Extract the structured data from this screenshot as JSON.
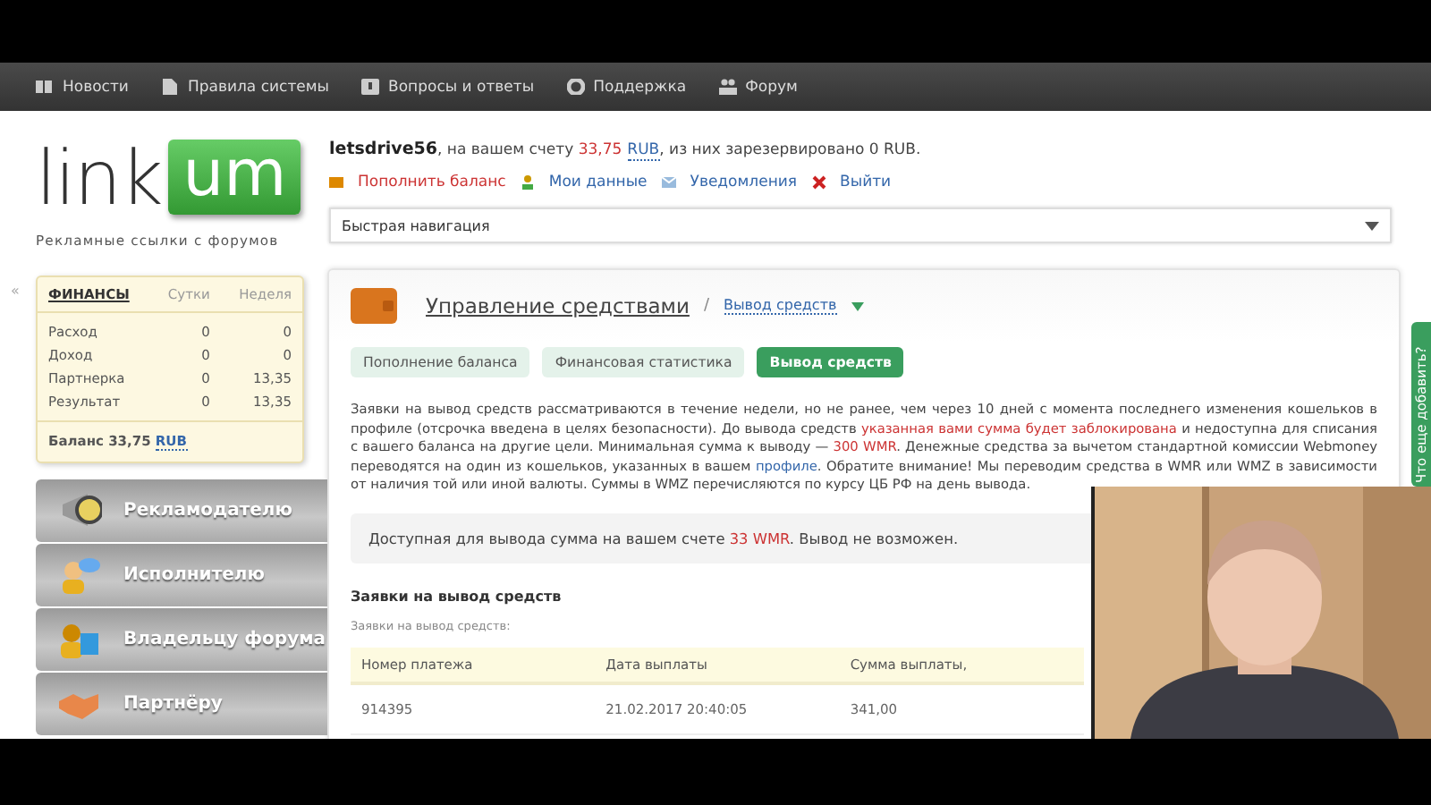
{
  "top_nav": {
    "items": [
      {
        "label": "Новости"
      },
      {
        "label": "Правила системы"
      },
      {
        "label": "Вопросы и ответы"
      },
      {
        "label": "Поддержка"
      },
      {
        "label": "Форум"
      }
    ]
  },
  "logo": {
    "text_left": "link",
    "text_right": "um",
    "tagline": "Рекламные ссылки с форумов"
  },
  "account": {
    "summary": [
      {
        "text": "letsdrive56",
        "kind": "strong"
      },
      {
        "text": ", на вашем счету ",
        "kind": "plain"
      },
      {
        "text": "33,75",
        "kind": "accent"
      },
      {
        "text": "RUB",
        "kind": "link"
      },
      {
        "text": ", из них зарезервировано 0 RUB.",
        "kind": "plain"
      }
    ],
    "links": [
      {
        "label": "Пополнить баланс",
        "kind": "deposit"
      },
      {
        "label": "Мои данные",
        "kind": "profile"
      },
      {
        "label": "Уведомления",
        "kind": "mail"
      },
      {
        "label": "Выйти",
        "kind": "logout"
      }
    ]
  },
  "quick_nav": {
    "value": "Быстрая навигация"
  },
  "collapse_toggle": "«",
  "finance": {
    "columns": [
      "ФИНАНСЫ",
      "Сутки",
      "Неделя"
    ],
    "rows": [
      [
        "Расход",
        "0",
        "0"
      ],
      [
        "Доход",
        "0",
        "0"
      ],
      [
        "Партнерка",
        "0",
        "13,35"
      ],
      [
        "Результат",
        "0",
        "13,35"
      ]
    ],
    "balance": [
      {
        "text": "Баланс 33,75 ",
        "kind": "strong"
      },
      {
        "text": "RUB",
        "kind": "link"
      }
    ]
  },
  "side_menu": [
    {
      "label": "Рекламодателю"
    },
    {
      "label": "Исполнителю"
    },
    {
      "label": "Владельцу форума"
    },
    {
      "label": "Партнёру"
    }
  ],
  "main": {
    "title": "Управление средствами",
    "separator": "/",
    "breadcrumb": "Вывод средств",
    "tabs": [
      {
        "label": "Пополнение баланса",
        "selected": false
      },
      {
        "label": "Финансовая статистика",
        "selected": false
      },
      {
        "label": "Вывод средств",
        "selected": true
      }
    ],
    "description": [
      {
        "text": "Заявки на вывод средств рассматриваются в течение недели, но не ранее, чем через 10 дней с момента последнего изменения кошельков в профиле (отсрочка введена в целях безопасности). До вывода средств ",
        "kind": "plain"
      },
      {
        "text": "указанная вами сумма будет заблокирована",
        "kind": "accent"
      },
      {
        "text": " и недоступна для списания с вашего баланса на другие цели. Минимальная сумма к выводу — ",
        "kind": "plain"
      },
      {
        "text": "300 WMR",
        "kind": "accent"
      },
      {
        "text": ". Денежные средства за вычетом стандартной комиссии Webmoney переводятся на один из кошельков, указанных в вашем ",
        "kind": "plain"
      },
      {
        "text": "профиле",
        "kind": "link"
      },
      {
        "text": ". Обратите внимание! Мы переводим средства в WMR или WMZ в зависимости от наличия той или иной валюты. Суммы в WMZ перечисляются по курсу ЦБ РФ на день вывода.",
        "kind": "plain"
      }
    ],
    "notice": [
      {
        "text": "Доступная для вывода сумма на вашем счете ",
        "kind": "plain"
      },
      {
        "text": "33 WMR",
        "kind": "accent"
      },
      {
        "text": ". Вывод не возможен.",
        "kind": "plain"
      }
    ],
    "requests": {
      "title": "Заявки на вывод средств",
      "caption": "Заявки на вывод средств:",
      "columns": [
        "Номер платежа",
        "Дата выплаты",
        "Сумма выплаты,"
      ],
      "rows": [
        [
          "914395",
          "21.02.2017 20:40:05",
          "341,00"
        ]
      ]
    }
  },
  "feedback_tab": "Что еще добавить?"
}
